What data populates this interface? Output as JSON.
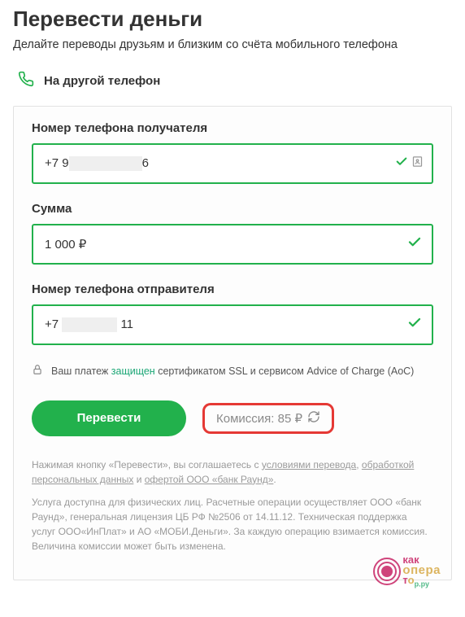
{
  "header": {
    "title": "Перевести деньги",
    "subtitle": "Делайте переводы друзьям и близким со счёта мобильного телефона"
  },
  "tab": {
    "label": "На другой телефон"
  },
  "form": {
    "recipient": {
      "label": "Номер телефона получателя",
      "prefix": "+7 9",
      "suffix": "6"
    },
    "amount": {
      "label": "Сумма",
      "value": "1 000 ₽"
    },
    "sender": {
      "label": "Номер телефона отправителя",
      "prefix": "+7 ",
      "suffix": " 11"
    }
  },
  "security": {
    "text_before": "Ваш платеж ",
    "link": "защищен",
    "text_after": " сертификатом SSL и сервисом Advice of Charge (AoC)"
  },
  "action": {
    "button": "Перевести",
    "commission_label": "Комиссия: ",
    "commission_value": "85 ₽"
  },
  "legal": {
    "line1_a": "Нажимая кнопку «Перевести», вы соглашаетесь с ",
    "line1_link1": "условиями перевода",
    "line1_b": ", ",
    "line1_link2": "обработкой персональных данных",
    "line1_c": " и ",
    "line1_link3": "офертой ООО «банк Раунд»",
    "line1_d": ".",
    "line2": "Услуга доступна для физических лиц. Расчетные операции осуществляет ООО «банк Раунд», генеральная лицензия ЦБ РФ №2506 от 14.11.12. Техническая поддержка услуг ООО«ИнПлат» и АО «МОБИ.Деньги». За каждую операцию взимается комиссия. Величина комиссии может быть изменена."
  },
  "watermark": {
    "l1": "как",
    "l2": "опера",
    "t": "т",
    "o": "о",
    "p": "р.ру"
  }
}
